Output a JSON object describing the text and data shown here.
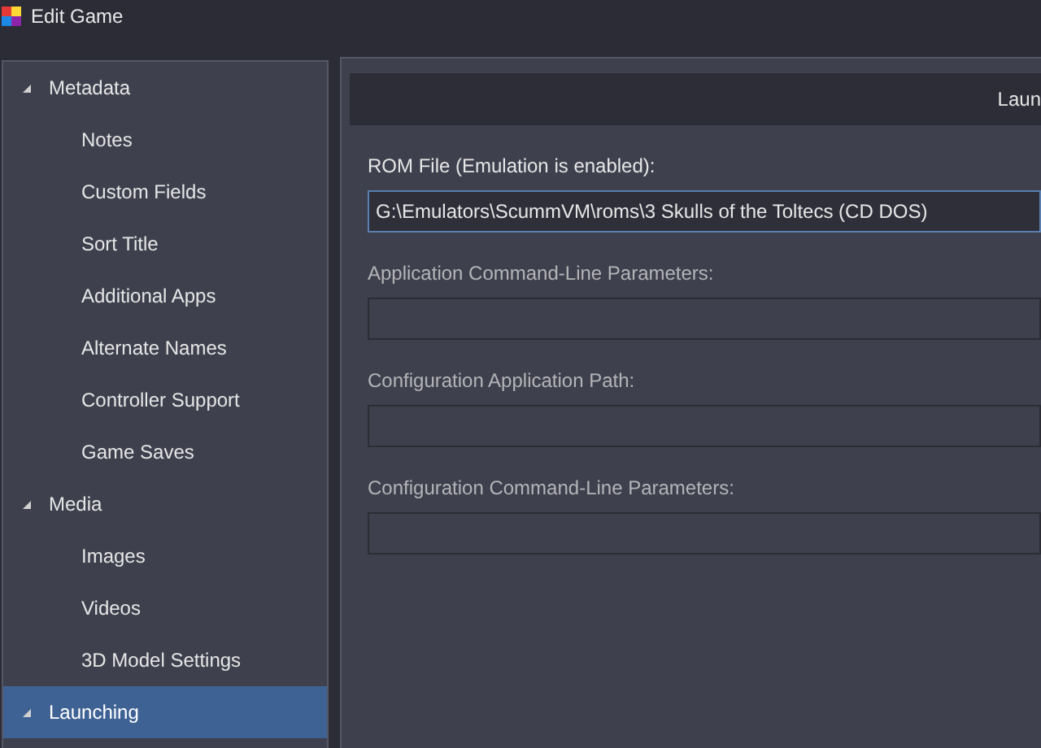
{
  "window": {
    "title": "Edit Game"
  },
  "sidebar": {
    "items": [
      {
        "label": "Metadata",
        "expanded": true,
        "selected": false,
        "children": [
          {
            "label": "Notes",
            "selected": false
          },
          {
            "label": "Custom Fields",
            "selected": false
          },
          {
            "label": "Sort Title",
            "selected": false
          },
          {
            "label": "Additional Apps",
            "selected": false
          },
          {
            "label": "Alternate Names",
            "selected": false
          },
          {
            "label": "Controller Support",
            "selected": false
          },
          {
            "label": "Game Saves",
            "selected": false
          }
        ]
      },
      {
        "label": "Media",
        "expanded": true,
        "selected": false,
        "children": [
          {
            "label": "Images",
            "selected": false
          },
          {
            "label": "Videos",
            "selected": false
          },
          {
            "label": "3D Model Settings",
            "selected": false
          }
        ]
      },
      {
        "label": "Launching",
        "expanded": true,
        "selected": true
      }
    ]
  },
  "panel": {
    "header": "Laun",
    "fields": [
      {
        "label": "ROM File (Emulation is enabled):",
        "value": "G:\\Emulators\\ScummVM\\roms\\3 Skulls of the Toltecs (CD DOS)",
        "focused": true
      },
      {
        "label": "Application Command-Line Parameters:",
        "focused": false
      },
      {
        "label": "Configuration Application Path:",
        "focused": false
      },
      {
        "label": "Configuration Command-Line Parameters:",
        "focused": false
      }
    ]
  }
}
